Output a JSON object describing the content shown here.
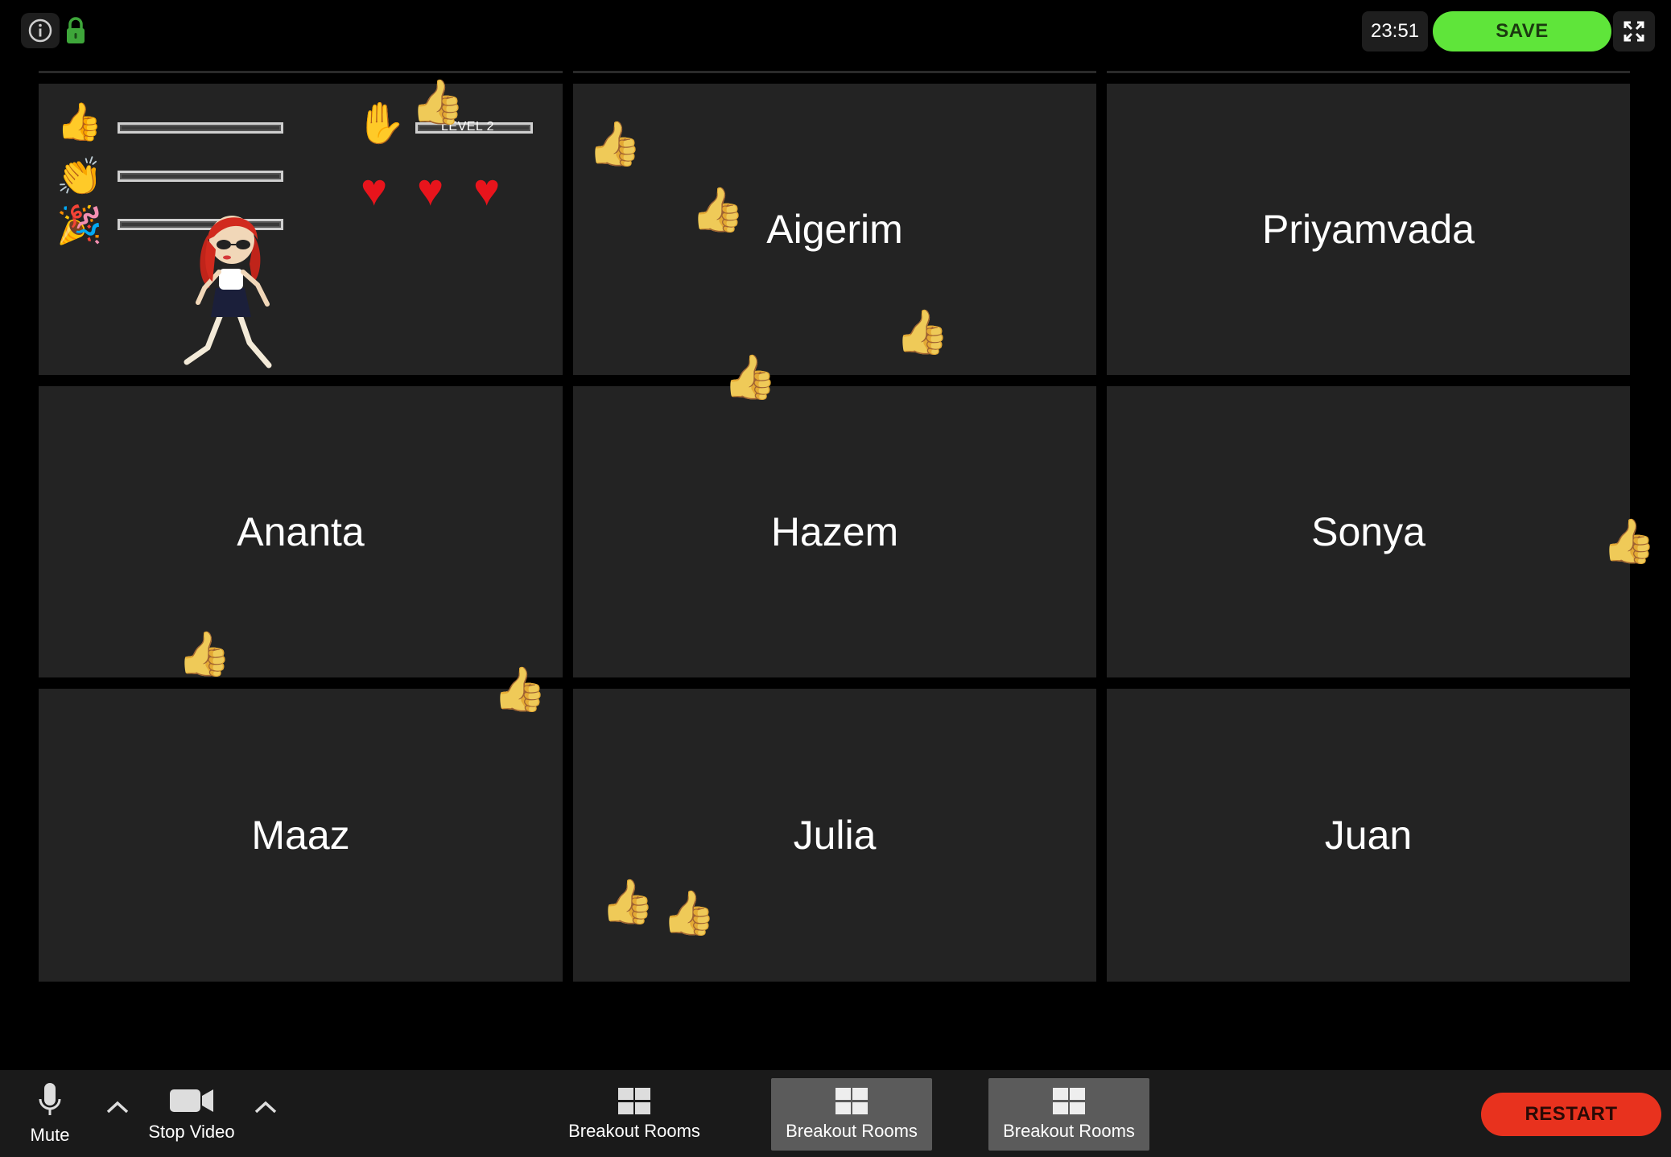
{
  "header": {
    "info_icon": "info-icon",
    "lock_icon": "lock-icon",
    "timer": "23:51",
    "save_label": "SAVE",
    "fullscreen_icon": "fullscreen-icon"
  },
  "game": {
    "level_label": "LEVEL 2",
    "reaction_icons": [
      "thumbs-up",
      "clapping-hands",
      "party-popper"
    ],
    "hand_icon": "raised-hand",
    "lives": 3,
    "character": "red-haired-girl-avatar"
  },
  "participants": [
    "Aigerim",
    "Priyamvada",
    "Ananta",
    "Hazem",
    "Sonya",
    "Maaz",
    "Julia",
    "Juan"
  ],
  "toolbar": {
    "mute_label": "Mute",
    "stop_video_label": "Stop Video",
    "breakout_1_label": "Breakout Rooms",
    "breakout_2_label": "Breakout Rooms",
    "breakout_3_label": "Breakout Rooms",
    "restart_label": "RESTART"
  },
  "colors": {
    "save": "#5fe53a",
    "restart": "#e8321e",
    "tile": "#232323",
    "background": "#000000"
  }
}
